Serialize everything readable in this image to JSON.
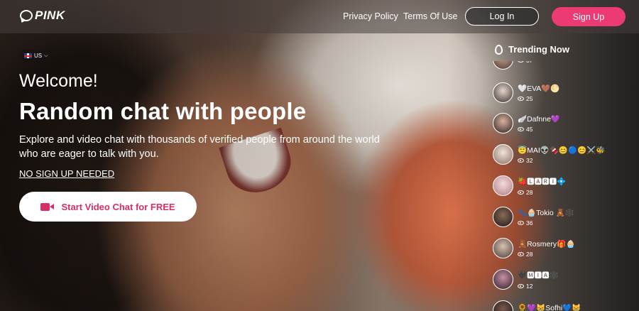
{
  "header": {
    "logo_text": "PINK",
    "nav": [
      "Privacy Policy",
      "Terms Of Use"
    ],
    "login_label": "Log In",
    "signup_label": "Sign Up",
    "colors": {
      "accent": "#ec3a72"
    }
  },
  "hero": {
    "language": "US",
    "welcome": "Welcome!",
    "headline": "Random chat with people",
    "description": "Explore and video chat with thousands of verified people from around the world who are eager to talk with you.",
    "no_signup": "NO SIGN UP NEEDED",
    "cta_label": "Start Video Chat for FREE",
    "cta_icon": "video-camera-icon"
  },
  "trending": {
    "title": "Trending Now",
    "title_icon": "flame-icon",
    "items": [
      {
        "name": "",
        "views": "37"
      },
      {
        "name": "🤍EVA🤎🌕",
        "views": "25"
      },
      {
        "name": "🪽Dafnne💜",
        "views": "45"
      },
      {
        "name": "😇MAI👽🍫😊🔵😊⚔️🐝",
        "views": "32"
      },
      {
        "name": "🍓🅻🅰🆁🅸💠",
        "views": "28"
      },
      {
        "name": "🐾🧁Tokio 🧸🕸️",
        "views": "36"
      },
      {
        "name": "🧸Rosmery🎁🧁",
        "views": "28"
      },
      {
        "name": "🖤🅼🅸🅰🕸️",
        "views": "12"
      },
      {
        "name": "🌻💜😸Sofhi💙😸",
        "views": ""
      }
    ]
  }
}
